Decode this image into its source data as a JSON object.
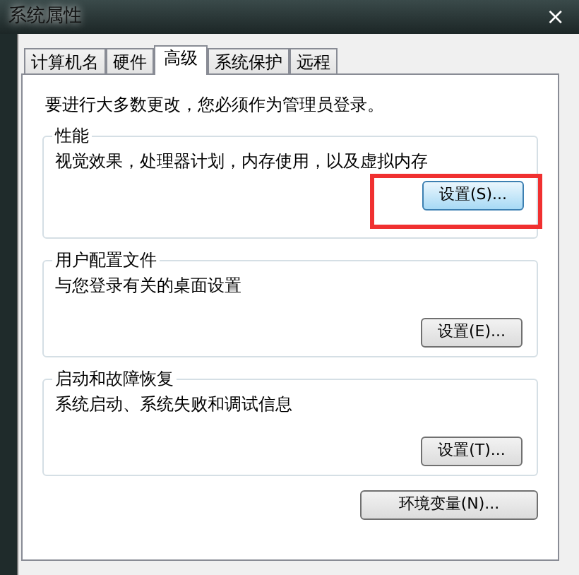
{
  "window": {
    "title": "系统属性",
    "close": "×"
  },
  "tabs": [
    {
      "label": "计算机名",
      "selected": false
    },
    {
      "label": "硬件",
      "selected": false
    },
    {
      "label": "高级",
      "selected": true
    },
    {
      "label": "系统保护",
      "selected": false
    },
    {
      "label": "远程",
      "selected": false
    }
  ],
  "notice": "要进行大多数更改，您必须作为管理员登录。",
  "groups": [
    {
      "title": "性能",
      "description": "视觉效果，处理器计划，内存使用，以及虚拟内存",
      "button": "设置(S)...",
      "focused": true,
      "highlighted": true
    },
    {
      "title": "用户配置文件",
      "description": "与您登录有关的桌面设置",
      "button": "设置(E)...",
      "focused": false,
      "highlighted": false
    },
    {
      "title": "启动和故障恢复",
      "description": "系统启动、系统失败和调试信息",
      "button": "设置(T)...",
      "focused": false,
      "highlighted": false
    }
  ],
  "env_button": "环境变量(N)..."
}
